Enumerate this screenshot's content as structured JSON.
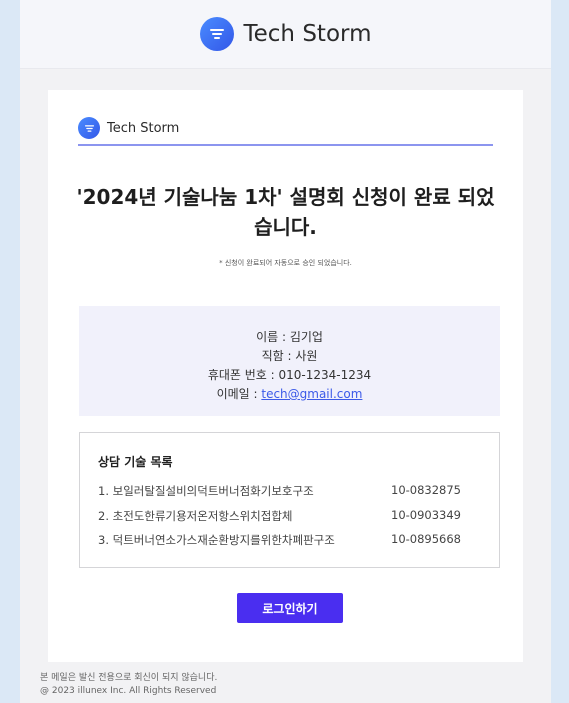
{
  "header": {
    "brand": "Tech Storm"
  },
  "card": {
    "brand": "Tech Storm",
    "title": "'2024년 기술나눔 1차' 설명회 신청이 완료 되었습니다.",
    "note": "* 신청이 완료되어 자동으로 승인 되었습니다."
  },
  "info": {
    "name_line": "이름 : 김기업",
    "position_line": "직함 : 사원",
    "phone_line": "휴대폰 번호 : 010-1234-1234",
    "email_label": "이메일 : ",
    "email": "tech@gmail.com"
  },
  "tech_list": {
    "title": "상담 기술 목록",
    "items": [
      {
        "name": "1. 보일러탈질설비의덕트버너점화기보호구조",
        "code": "10-0832875"
      },
      {
        "name": "2. 초전도한류기용저온저항스위치접합체",
        "code": "10-0903349"
      },
      {
        "name": "3. 덕트버너연소가스재순환방지를위한차폐판구조",
        "code": "10-0895668"
      }
    ]
  },
  "button": {
    "login": "로그인하기"
  },
  "footer": {
    "line1": "본 메일은 발신 전용으로 회신이 되지 않습니다.",
    "line2": "@ 2023 illunex Inc. All Rights Reserved"
  },
  "colors": {
    "accent": "#4a2ef0",
    "brand_blue": "#3c6ef0",
    "info_bg": "#f1f1fb"
  }
}
